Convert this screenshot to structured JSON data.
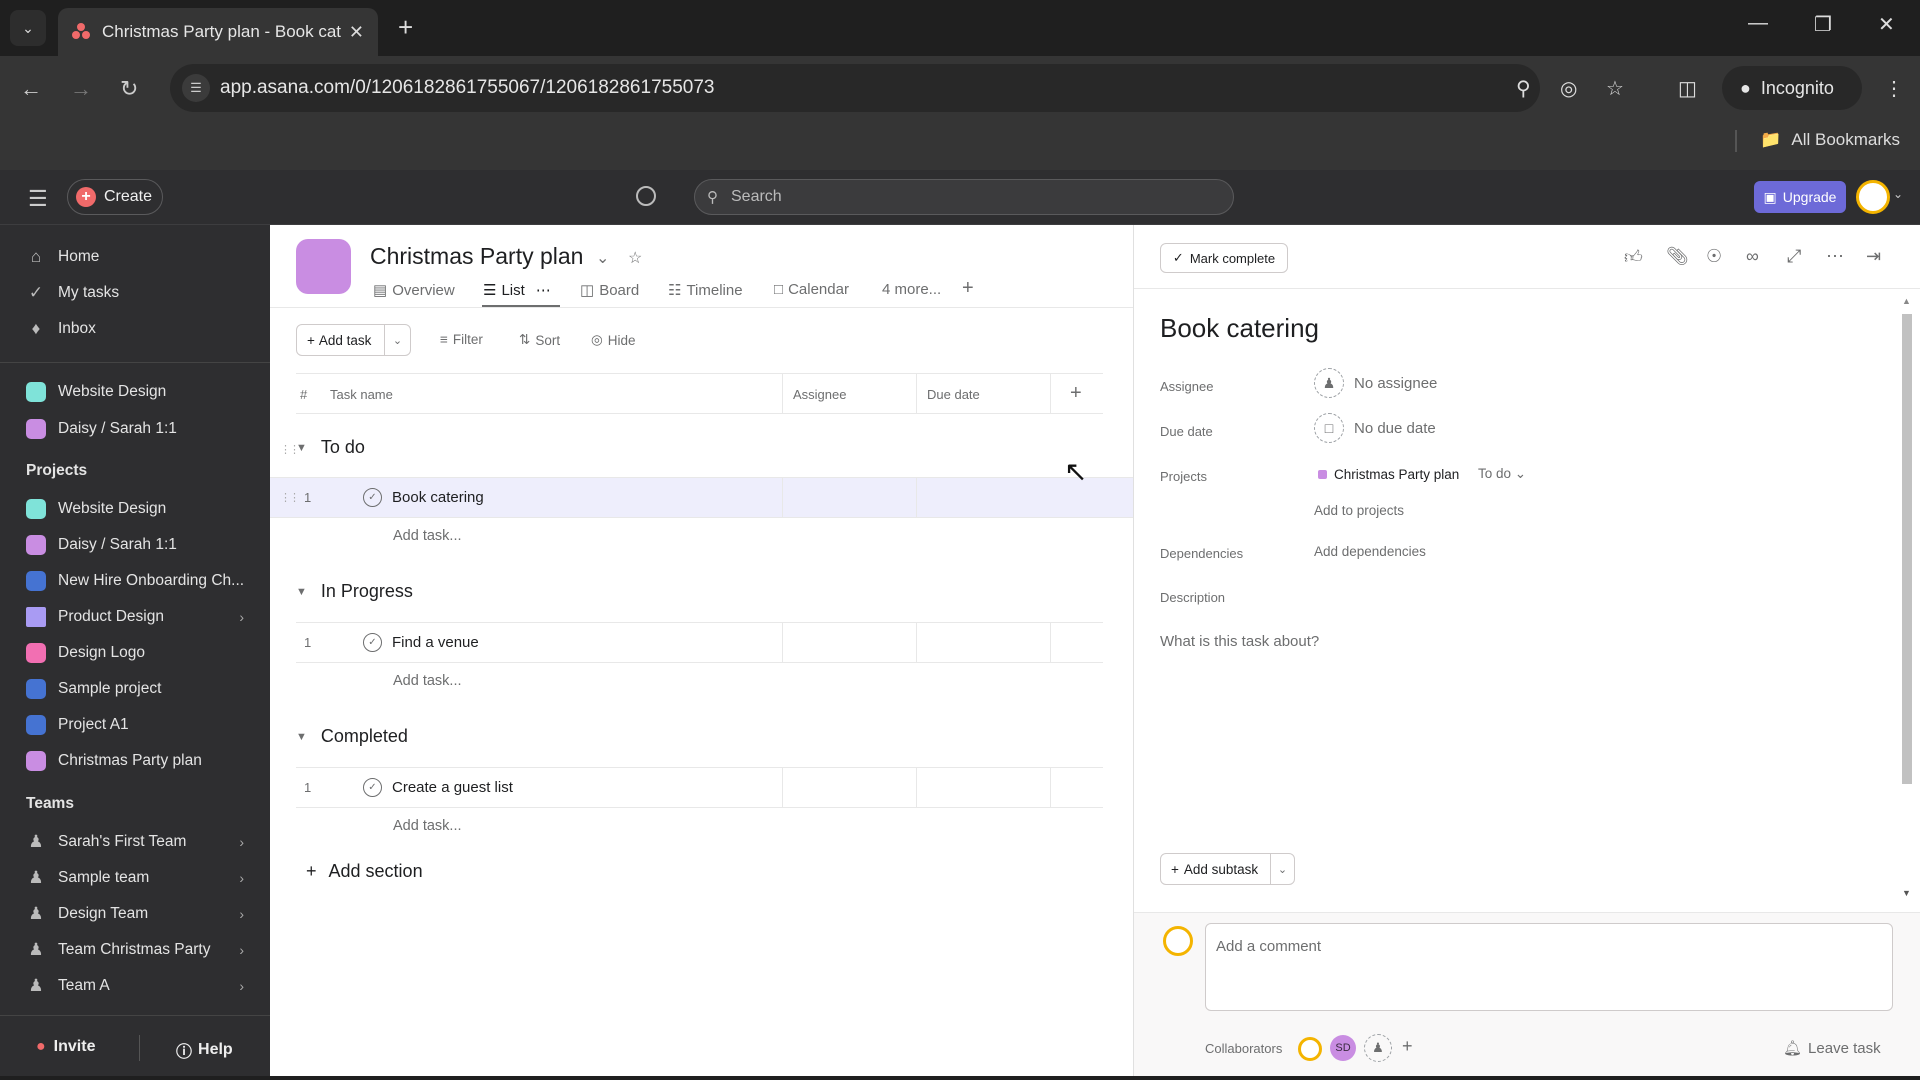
{
  "browser": {
    "tab_title": "Christmas Party plan - Book cat",
    "url": "app.asana.com/0/1206182861755067/1206182861755073",
    "incognito_label": "Incognito",
    "bookmarks_label": "All Bookmarks",
    "icons": {
      "tab_list": "chevron-down-icon",
      "close_tab": "close-icon",
      "new_tab": "plus-icon",
      "minimize": "minimize-icon",
      "restore": "restore-icon",
      "close_window": "close-icon",
      "back": "arrow-left-icon",
      "forward": "arrow-right-icon",
      "reload": "reload-icon",
      "site_info": "tune-icon",
      "zoom": "zoom-icon",
      "eye_off": "eye-off-icon",
      "star": "star-icon",
      "side_panel": "side-panel-icon",
      "menu": "more-vert-icon",
      "folder": "folder-icon"
    }
  },
  "topbar": {
    "create_label": "Create",
    "search_placeholder": "Search",
    "upgrade_label": "Upgrade"
  },
  "sidebar": {
    "nav": [
      {
        "label": "Home",
        "icon": "home-icon"
      },
      {
        "label": "My tasks",
        "icon": "check-circle-icon"
      },
      {
        "label": "Inbox",
        "icon": "bell-icon"
      }
    ],
    "favorites": [
      {
        "label": "Website Design",
        "color": "#7fe3d9"
      },
      {
        "label": "Daisy / Sarah 1:1",
        "color": "#c98de2",
        "locked": true
      }
    ],
    "projects_heading": "Projects",
    "projects": [
      {
        "label": "Website Design",
        "color": "#7fe3d9"
      },
      {
        "label": "Daisy / Sarah 1:1",
        "color": "#c98de2",
        "locked": true
      },
      {
        "label": "New Hire Onboarding Ch...",
        "color": "#4573d2"
      },
      {
        "label": "Product Design",
        "color": "#a99bf3",
        "folder": true
      },
      {
        "label": "Design Logo",
        "color": "#f26fb2"
      },
      {
        "label": "Sample project",
        "color": "#4573d2"
      },
      {
        "label": "Project A1",
        "color": "#4573d2"
      },
      {
        "label": "Christmas Party plan",
        "color": "#c98de2"
      }
    ],
    "teams_heading": "Teams",
    "teams": [
      {
        "label": "Sarah's First Team"
      },
      {
        "label": "Sample team"
      },
      {
        "label": "Design Team"
      },
      {
        "label": "Team Christmas Party"
      },
      {
        "label": "Team A"
      }
    ],
    "invite_label": "Invite",
    "help_label": "Help"
  },
  "project": {
    "title": "Christmas Party plan",
    "tabs": [
      {
        "label": "Overview",
        "icon": "overview-icon"
      },
      {
        "label": "List",
        "icon": "list-icon",
        "active": true
      },
      {
        "label": "Board",
        "icon": "board-icon"
      },
      {
        "label": "Timeline",
        "icon": "timeline-icon"
      },
      {
        "label": "Calendar",
        "icon": "calendar-icon"
      },
      {
        "label": "4 more..."
      }
    ],
    "toolbar": {
      "add_task": "Add task",
      "filter": "Filter",
      "sort": "Sort",
      "hide": "Hide"
    },
    "columns": {
      "number": "#",
      "task_name": "Task name",
      "assignee": "Assignee",
      "due_date": "Due date"
    },
    "sections": [
      {
        "name": "To do",
        "tasks": [
          {
            "num": "1",
            "name": "Book catering",
            "selected": true
          }
        ]
      },
      {
        "name": "In Progress",
        "tasks": [
          {
            "num": "1",
            "name": "Find a venue"
          }
        ]
      },
      {
        "name": "Completed",
        "tasks": [
          {
            "num": "1",
            "name": "Create a guest list"
          }
        ]
      }
    ],
    "add_task_inline": "Add task...",
    "add_section": "Add section"
  },
  "detail": {
    "mark_complete": "Mark complete",
    "header_icons": [
      "thumbs-up-icon",
      "attachment-icon",
      "subtask-icon",
      "link-icon",
      "expand-icon",
      "more-icon",
      "close-pane-icon"
    ],
    "title": "Book catering",
    "fields": {
      "assignee_label": "Assignee",
      "assignee_value": "No assignee",
      "due_label": "Due date",
      "due_value": "No due date",
      "projects_label": "Projects",
      "project_name": "Christmas Party plan",
      "project_section": "To do",
      "add_to_projects": "Add to projects",
      "dependencies_label": "Dependencies",
      "add_dependencies": "Add dependencies",
      "description_label": "Description",
      "description_placeholder": "What is this task about?"
    },
    "add_subtask": "Add subtask",
    "comment_placeholder": "Add a comment",
    "collaborators_label": "Collaborators",
    "collaborator_initials": "SD",
    "leave_task": "Leave task"
  }
}
